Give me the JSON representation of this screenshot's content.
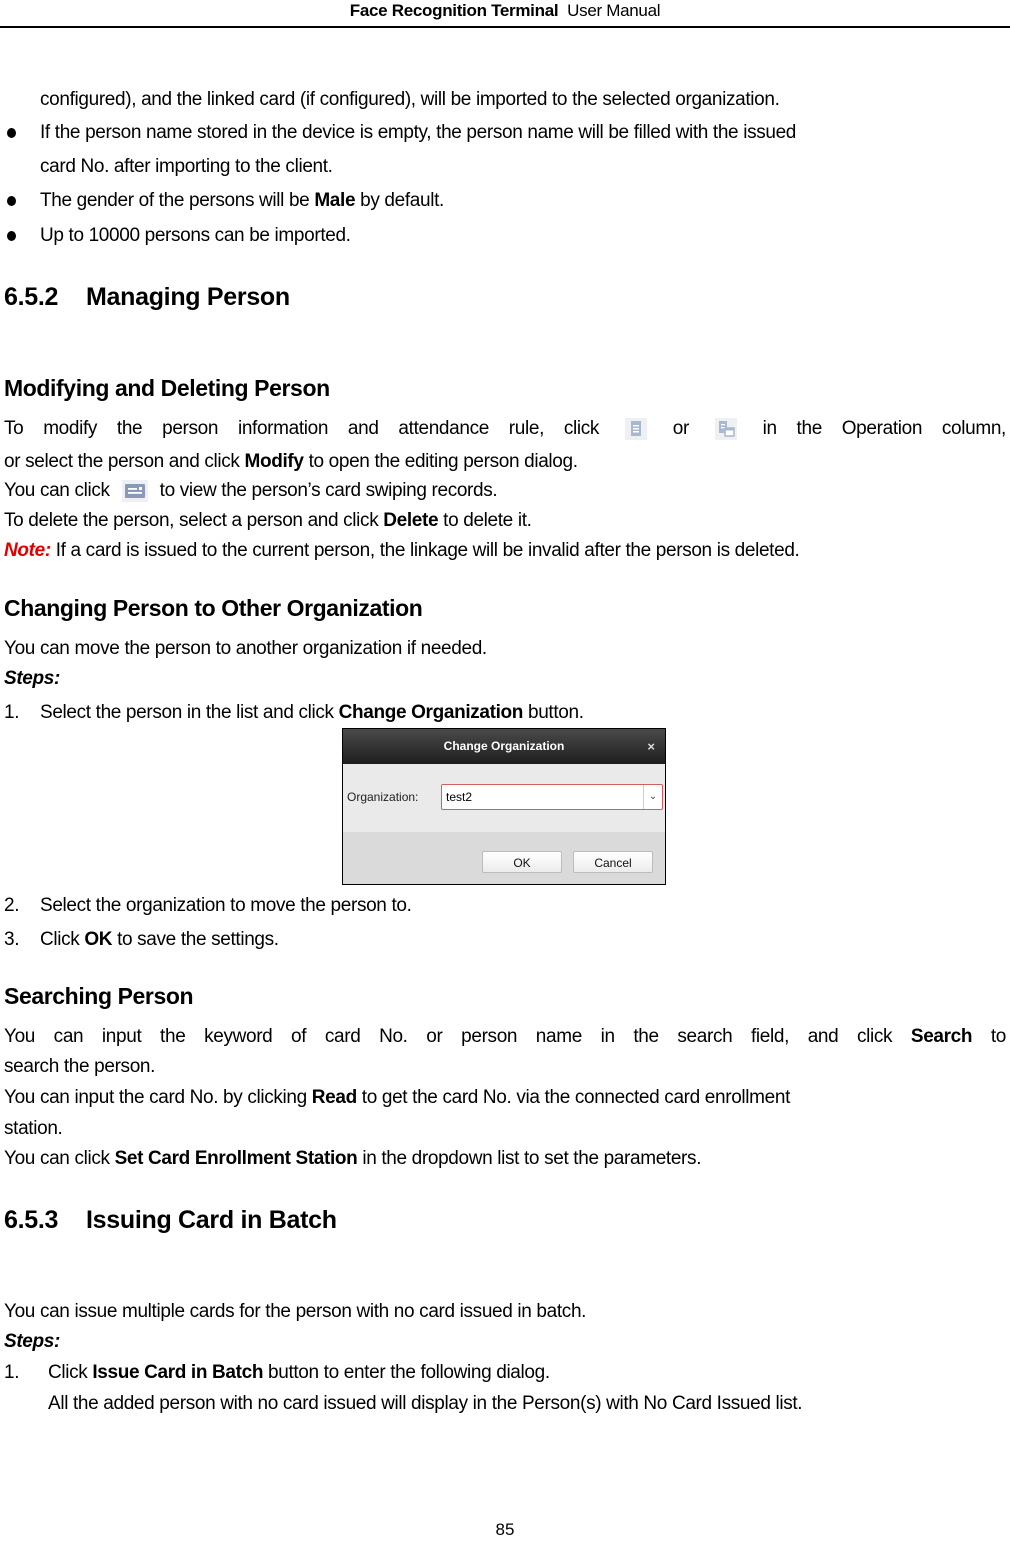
{
  "header": {
    "title_bold": "Face Recognition Terminal",
    "title_rest": "User Manual"
  },
  "intro": {
    "continuation": "configured), and the linked card (if configured), will be imported to the selected organization.",
    "bullets": [
      {
        "line1": "If the person name stored in the device is empty, the person name will be filled with the issued",
        "line2": "card No. after importing to the client."
      },
      {
        "pre": "The gender of the persons will be ",
        "bold": "Male",
        "post": " by default."
      },
      {
        "text": "Up to 10000 persons can be imported."
      }
    ]
  },
  "section_652": {
    "number": "6.5.2",
    "title": "Managing Person"
  },
  "modify_delete": {
    "heading": "Modifying and Deleting Person",
    "p1_pre": "To modify the person information and attendance rule, click",
    "p1_or": "or",
    "p1_post": "in the Operation column,",
    "p1_line2_pre": "or select the person and click ",
    "p1_line2_bold": "Modify",
    "p1_line2_post": " to open the editing person dialog.",
    "p2_pre": "You can click",
    "p2_post": "to view the person’s card swiping records.",
    "p3_pre": "To delete the person, select a person and click ",
    "p3_bold": "Delete",
    "p3_post": " to delete it.",
    "note_label": "Note:",
    "note_text": " If a card is issued to the current person, the linkage will be invalid after the person is deleted.",
    "icons": [
      "edit-document-icon",
      "attendance-rule-icon",
      "card-record-icon"
    ]
  },
  "change_org": {
    "heading": "Changing Person to Other Organization",
    "intro": "You can move the person to another organization if needed.",
    "steps_label": "Steps:",
    "step1_num": "1.",
    "step1_pre": "Select the person in the list and click ",
    "step1_bold": "Change Organization",
    "step1_post": " button.",
    "step2_num": "2.",
    "step2": "Select the organization to move the person to.",
    "step3_num": "3.",
    "step3_pre": "Click ",
    "step3_bold": "OK",
    "step3_post": " to save the settings.",
    "dialog": {
      "title": "Change Organization",
      "close": "×",
      "org_label": "Organization:",
      "org_value": "test2",
      "ok": "OK",
      "cancel": "Cancel"
    }
  },
  "searching": {
    "heading": "Searching Person",
    "p1_pre": "You can input the keyword of card No. or person name in the search field, and click",
    "p1_bold": "Search",
    "p1_post": "to",
    "p1_line2": "search the person.",
    "p2_pre": "You can input the card No. by clicking ",
    "p2_bold": "Read",
    "p2_post": " to get the card No. via the connected card enrollment",
    "p2_line2": "station.",
    "p3_pre": "You can click ",
    "p3_bold": "Set Card Enrollment Station",
    "p3_post": " in the dropdown list to set the parameters."
  },
  "section_653": {
    "number": "6.5.3",
    "title": "Issuing Card in Batch"
  },
  "issuing": {
    "intro": "You can issue multiple cards for the person with no card issued in batch.",
    "steps_label": "Steps:",
    "step1_num": "1.",
    "step1_pre": "Click ",
    "step1_bold": "Issue Card in Batch",
    "step1_post": " button to enter the following dialog.",
    "step1_line2": "All the added person with no card issued will display in the Person(s) with No Card Issued list."
  },
  "footer": {
    "page_number": "85"
  }
}
